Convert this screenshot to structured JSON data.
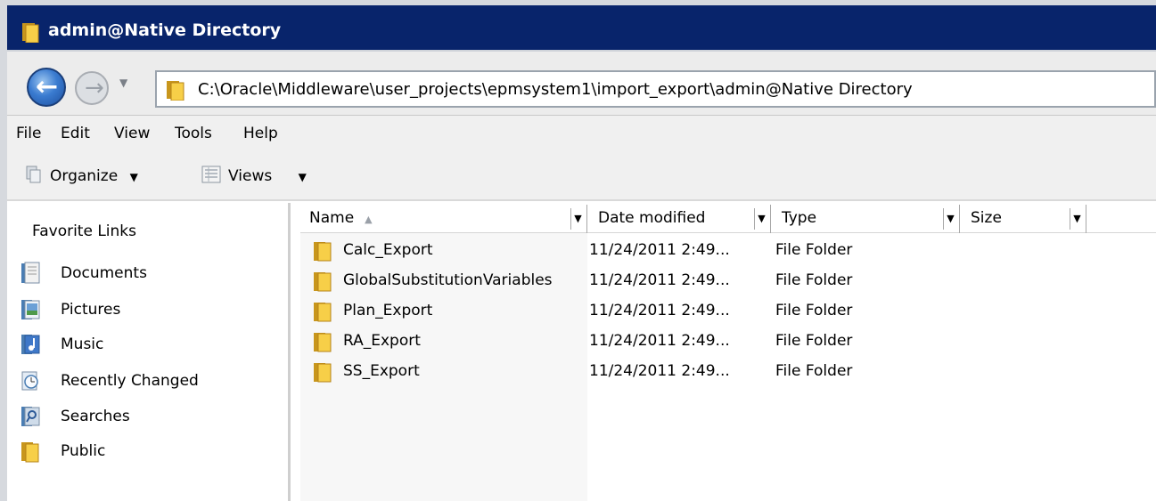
{
  "window": {
    "title": "admin@Native Directory"
  },
  "address": {
    "path": "C:\\Oracle\\Middleware\\user_projects\\epmsystem1\\import_export\\admin@Native Directory"
  },
  "menu": [
    "File",
    "Edit",
    "View",
    "Tools",
    "Help"
  ],
  "toolbar": {
    "organize": "Organize",
    "views": "Views"
  },
  "nav": {
    "title": "Favorite Links",
    "links": [
      {
        "label": "Documents",
        "icon": "documents-icon"
      },
      {
        "label": "Pictures",
        "icon": "pictures-icon"
      },
      {
        "label": "Music",
        "icon": "music-icon"
      },
      {
        "label": "Recently Changed",
        "icon": "recently-changed-icon"
      },
      {
        "label": "Searches",
        "icon": "searches-icon"
      },
      {
        "label": "Public",
        "icon": "folder-icon"
      }
    ]
  },
  "columns": {
    "name": "Name",
    "date": "Date modified",
    "type": "Type",
    "size": "Size"
  },
  "files": [
    {
      "name": "Calc_Export",
      "date": "11/24/2011 2:49...",
      "type": "File Folder"
    },
    {
      "name": "GlobalSubstitutionVariables",
      "date": "11/24/2011 2:49...",
      "type": "File Folder"
    },
    {
      "name": "Plan_Export",
      "date": "11/24/2011 2:49...",
      "type": "File Folder"
    },
    {
      "name": "RA_Export",
      "date": "11/24/2011 2:49...",
      "type": "File Folder"
    },
    {
      "name": "SS_Export",
      "date": "11/24/2011 2:49...",
      "type": "File Folder"
    }
  ],
  "colors": {
    "titlebar": "#08246b",
    "folder": "#f2c230"
  }
}
